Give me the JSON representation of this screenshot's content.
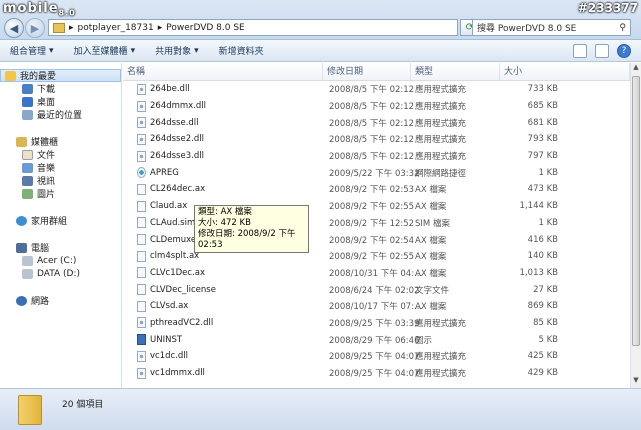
{
  "watermark": {
    "logo_main": "mobile",
    "logo_version": "8.0",
    "id": "#233377"
  },
  "address": {
    "breadcrumb": [
      "potplayer_18731",
      "PowerDVD 8.0 SE"
    ],
    "search_placeholder": "搜尋 PowerDVD 8.0 SE"
  },
  "toolbar": {
    "organize": "組合管理",
    "add_to_library": "加入至媒體櫃",
    "share": "共用對象",
    "new_folder": "新增資料夾"
  },
  "nav": {
    "favorites": "我的最愛",
    "downloads": "下載",
    "desktop": "桌面",
    "recent": "最近的位置",
    "libraries": "媒體櫃",
    "documents": "文件",
    "music": "音樂",
    "videos": "視訊",
    "pictures": "圖片",
    "homegroup": "家用群組",
    "computer": "電腦",
    "drive_c": "Acer (C:)",
    "drive_d": "DATA (D:)",
    "network": "網路"
  },
  "columns": {
    "name": "名稱",
    "date": "修改日期",
    "type": "類型",
    "size": "大小"
  },
  "files": [
    {
      "name": "264be.dll",
      "date": "2008/8/5 下午 02:12",
      "type": "應用程式擴充",
      "size": "733 KB",
      "icon": "gear"
    },
    {
      "name": "264dmmx.dll",
      "date": "2008/8/5 下午 02:12",
      "type": "應用程式擴充",
      "size": "685 KB",
      "icon": "gear"
    },
    {
      "name": "264dsse.dll",
      "date": "2008/8/5 下午 02:12",
      "type": "應用程式擴充",
      "size": "681 KB",
      "icon": "gear"
    },
    {
      "name": "264dsse2.dll",
      "date": "2008/8/5 下午 02:12",
      "type": "應用程式擴充",
      "size": "793 KB",
      "icon": "gear"
    },
    {
      "name": "264dsse3.dll",
      "date": "2008/8/5 下午 02:12",
      "type": "應用程式擴充",
      "size": "797 KB",
      "icon": "gear"
    },
    {
      "name": "APREG",
      "date": "2009/5/22 下午 03:32",
      "type": "網際網路捷徑",
      "size": "1 KB",
      "icon": "reg"
    },
    {
      "name": "CL264dec.ax",
      "date": "2008/9/2 下午 02:53",
      "type": "AX 檔案",
      "size": "473 KB",
      "icon": "file"
    },
    {
      "name": "Claud.ax",
      "date": "2008/9/2 下午 02:55",
      "type": "AX 檔案",
      "size": "1,144 KB",
      "icon": "file"
    },
    {
      "name": "CLAud.sim",
      "date": "2008/9/2 下午 12:52",
      "type": "SIM 檔案",
      "size": "1 KB",
      "icon": "file"
    },
    {
      "name": "CLDemuxer.ax",
      "date": "2008/9/2 下午 02:54",
      "type": "AX 檔案",
      "size": "416 KB",
      "icon": "file"
    },
    {
      "name": "clm4splt.ax",
      "date": "2008/9/2 下午 02:55",
      "type": "AX 檔案",
      "size": "140 KB",
      "icon": "file"
    },
    {
      "name": "CLVc1Dec.ax",
      "date": "2008/10/31 下午 04:...",
      "type": "AX 檔案",
      "size": "1,013 KB",
      "icon": "file"
    },
    {
      "name": "CLVDec_license",
      "date": "2008/6/24 下午 02:02",
      "type": "文字文件",
      "size": "27 KB",
      "icon": "file"
    },
    {
      "name": "CLVsd.ax",
      "date": "2008/10/17 下午 07:...",
      "type": "AX 檔案",
      "size": "869 KB",
      "icon": "file"
    },
    {
      "name": "pthreadVC2.dll",
      "date": "2008/9/25 下午 03:39",
      "type": "應用程式擴充",
      "size": "85 KB",
      "icon": "gear"
    },
    {
      "name": "UNINST",
      "date": "2008/8/29 下午 06:46",
      "type": "圖示",
      "size": "5 KB",
      "icon": "app"
    },
    {
      "name": "vc1dc.dll",
      "date": "2008/9/25 下午 04:07",
      "type": "應用程式擴充",
      "size": "425 KB",
      "icon": "gear"
    },
    {
      "name": "vc1dmmx.dll",
      "date": "2008/9/25 下午 04:07",
      "type": "應用程式擴充",
      "size": "429 KB",
      "icon": "gear"
    }
  ],
  "tooltip": {
    "type": "類型: AX 檔案",
    "size": "大小: 472 KB",
    "date": "修改日期: 2008/9/2 下午 02:53"
  },
  "status": {
    "count": "20 個項目"
  }
}
